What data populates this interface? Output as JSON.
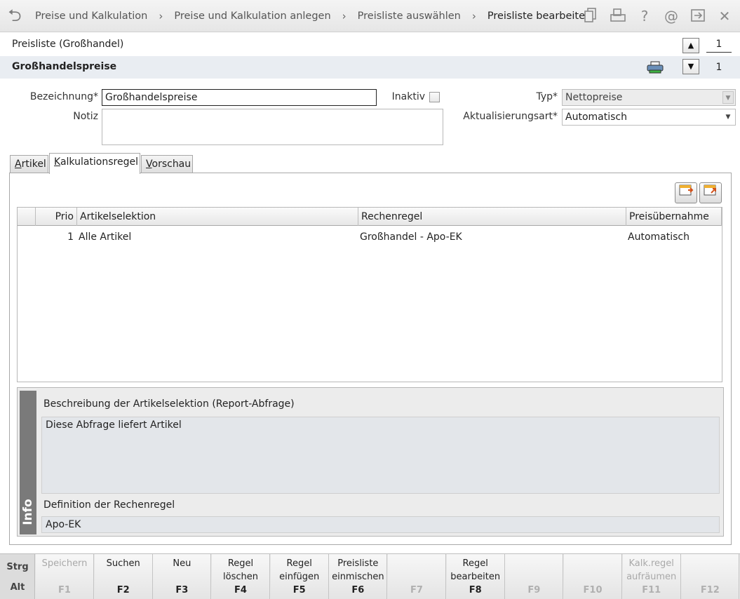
{
  "breadcrumb": {
    "items": [
      "Preise und Kalkulation",
      "Preise und Kalkulation anlegen",
      "Preisliste auswählen"
    ],
    "current": "Preisliste bearbeiten"
  },
  "header_icons": [
    "copy-icon",
    "print-icon",
    "help-icon",
    "email-icon",
    "export-icon",
    "close-icon"
  ],
  "record": {
    "list_title": "Preisliste (Großhandel)",
    "name_title": "Großhandelspreise",
    "counter_top": "1",
    "counter_bottom": "1"
  },
  "form": {
    "bezeichnung_label": "Bezeichnung*",
    "bezeichnung_value": "Großhandelspreise",
    "inaktiv_label": "Inaktiv",
    "notiz_label": "Notiz",
    "notiz_value": "",
    "typ_label": "Typ*",
    "typ_value": "Nettopreise",
    "aktualisierung_label": "Aktualisierungsart*",
    "aktualisierung_value": "Automatisch"
  },
  "tabs": [
    {
      "label": "Artikel",
      "active": false
    },
    {
      "label": "Kalkulationsregel",
      "active": true
    },
    {
      "label": "Vorschau",
      "active": false
    }
  ],
  "table": {
    "columns": [
      "",
      "Prio",
      "Artikelselektion",
      "Rechenregel",
      "Preisübernahme"
    ],
    "rows": [
      {
        "prio": "1",
        "selection": "Alle Artikel",
        "rule": "Großhandel - Apo-EK",
        "transfer": "Automatisch"
      }
    ]
  },
  "info": {
    "tag": "Info",
    "selection_heading": "Beschreibung der Artikelselektion (Report-Abfrage)",
    "selection_text": "Diese Abfrage liefert Artikel",
    "rule_heading": "Definition der Rechenregel",
    "rule_text": "Apo-EK"
  },
  "fkeys": {
    "modifiers": [
      "Strg",
      "Alt"
    ],
    "keys": [
      {
        "label": "Speichern",
        "key": "F1",
        "enabled": false
      },
      {
        "label": "Suchen",
        "key": "F2",
        "enabled": true
      },
      {
        "label": "Neu",
        "key": "F3",
        "enabled": true
      },
      {
        "label": "Regel\nlöschen",
        "key": "F4",
        "enabled": true
      },
      {
        "label": "Regel\neinfügen",
        "key": "F5",
        "enabled": true
      },
      {
        "label": "Preisliste\neinmischen",
        "key": "F6",
        "enabled": true
      },
      {
        "label": "",
        "key": "F7",
        "enabled": false
      },
      {
        "label": "Regel\nbearbeiten",
        "key": "F8",
        "enabled": true
      },
      {
        "label": "",
        "key": "F9",
        "enabled": false
      },
      {
        "label": "",
        "key": "F10",
        "enabled": false
      },
      {
        "label": "Kalk.regel\naufräumen",
        "key": "F11",
        "enabled": false
      },
      {
        "label": "",
        "key": "F12",
        "enabled": false
      }
    ]
  }
}
